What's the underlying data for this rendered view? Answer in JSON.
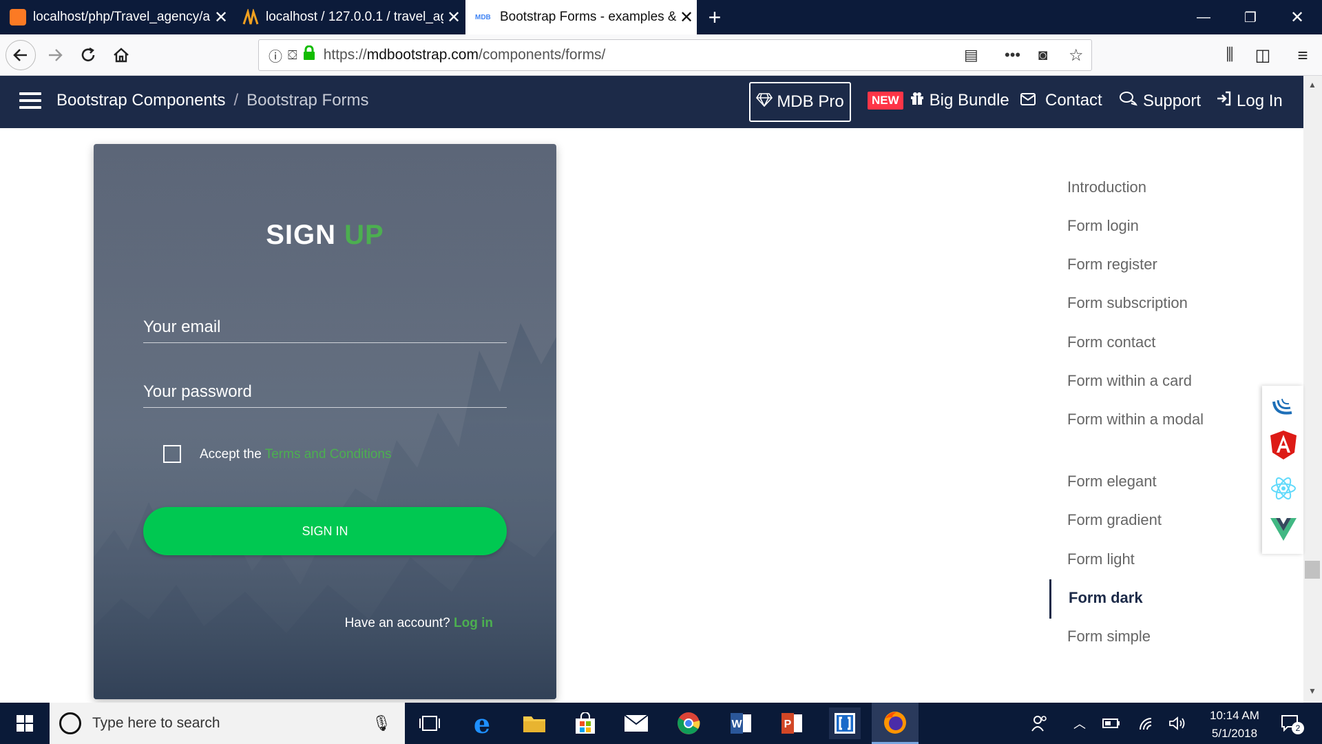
{
  "browser": {
    "tabs": [
      {
        "title": "localhost/php/Travel_agency/a",
        "active": false
      },
      {
        "title": "localhost / 127.0.0.1 / travel_ag",
        "active": false
      },
      {
        "title": "Bootstrap Forms - examples &",
        "active": true
      }
    ],
    "url_prefix": "https://",
    "url_domain": "mdbootstrap.com",
    "url_path": "/components/forms/"
  },
  "site_nav": {
    "breadcrumb_root": "Bootstrap Components",
    "breadcrumb_sep": "/",
    "breadcrumb_current": "Bootstrap Forms",
    "mdb_pro": "MDB Pro",
    "new_badge": "NEW",
    "big_bundle": "Big Bundle",
    "contact": "Contact",
    "support": "Support",
    "login": "Log In"
  },
  "form": {
    "title_sign": "SIGN",
    "title_up": "UP",
    "email_placeholder": "Your email",
    "password_placeholder": "Your password",
    "accept_text": "Accept the",
    "terms_link": "Terms and Conditions",
    "submit_label": "SIGN IN",
    "have_account": "Have an account?",
    "login_link": "Log in"
  },
  "toc": {
    "items": [
      "Introduction",
      "Form login",
      "Form register",
      "Form subscription",
      "Form contact",
      "Form within a card",
      "Form within a modal",
      "Form elegant",
      "Form gradient",
      "Form light",
      "Form dark",
      "Form simple"
    ],
    "active_index": 10
  },
  "framework_icons": [
    "jquery-icon",
    "angular-icon",
    "react-icon",
    "vue-icon"
  ],
  "taskbar": {
    "search_placeholder": "Type here to search",
    "time": "10:14 AM",
    "date": "5/1/2018",
    "notification_count": "2"
  },
  "colors": {
    "accent_green": "#00c851",
    "link_green": "#4caf50",
    "navbar_bg": "#1c2a48",
    "new_badge": "#ff3547"
  }
}
